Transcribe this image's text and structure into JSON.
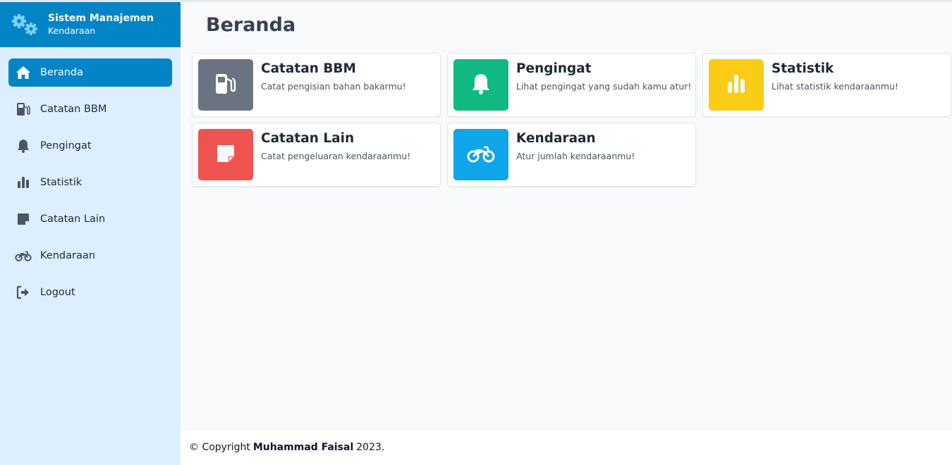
{
  "brand": {
    "title": "Sistem Manajemen",
    "subtitle": "Kendaraan",
    "icon": "gears-icon"
  },
  "sidebar": {
    "items": [
      {
        "label": "Beranda",
        "icon": "home-icon",
        "active": true
      },
      {
        "label": "Catatan BBM",
        "icon": "gas-pump-icon"
      },
      {
        "label": "Pengingat",
        "icon": "bell-icon"
      },
      {
        "label": "Statistik",
        "icon": "bar-chart-icon"
      },
      {
        "label": "Catatan Lain",
        "icon": "note-icon"
      },
      {
        "label": "Kendaraan",
        "icon": "motorcycle-icon"
      },
      {
        "label": "Logout",
        "icon": "logout-icon"
      }
    ]
  },
  "main": {
    "title": "Beranda",
    "cards": [
      {
        "title": "Catatan BBM",
        "desc": "Catat pengisian bahan bakarmu!",
        "color": "#6b7280",
        "icon": "gas-pump-icon"
      },
      {
        "title": "Pengingat",
        "desc": "Lihat pengingat yang sudah kamu atur!",
        "color": "#10b981",
        "icon": "bell-icon"
      },
      {
        "title": "Statistik",
        "desc": "Lihat statistik kendaraanmu!",
        "color": "#facc15",
        "icon": "bar-chart-icon"
      },
      {
        "title": "Catatan Lain",
        "desc": "Catat pengeluaran kendaraanmu!",
        "color": "#ef5350",
        "icon": "note-icon"
      },
      {
        "title": "Kendaraan",
        "desc": "Atur jumlah kendaraanmu!",
        "color": "#0ea5e9",
        "icon": "motorcycle-icon"
      }
    ]
  },
  "footer": {
    "prefix": "© Copyright",
    "author": "Muhammad Faisal",
    "year": "2023."
  },
  "colors": {
    "brand": "#0284c7",
    "sidebar_bg": "#ddeeff",
    "main_bg": "#f8fafc"
  }
}
